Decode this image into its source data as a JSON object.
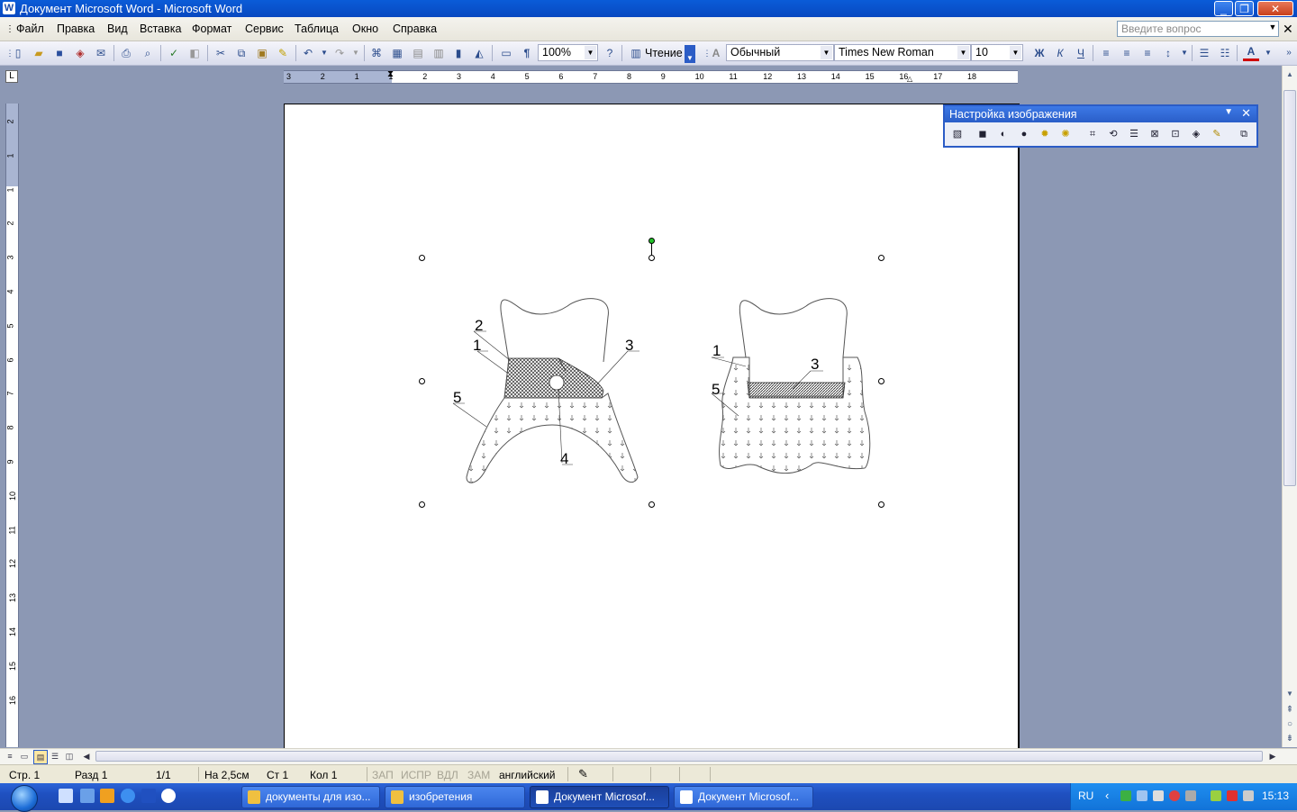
{
  "window": {
    "title": "Документ Microsoft Word - Microsoft Word",
    "app_icon": "W",
    "controls": [
      "_",
      "❐",
      "✕"
    ]
  },
  "menu": {
    "items": [
      "Файл",
      "Правка",
      "Вид",
      "Вставка",
      "Формат",
      "Сервис",
      "Таблица",
      "Окно",
      "Справка"
    ],
    "help_placeholder": "Введите вопрос",
    "help_close": "✕"
  },
  "toolbar": {
    "zoom": "100%",
    "reading_label": "Чтение",
    "style": "Обычный",
    "font": "Times New Roman",
    "font_size": "10",
    "bold": "Ж",
    "italic": "К",
    "underline": "Ч",
    "font_color_letter": "A"
  },
  "ruler": {
    "corner": "L",
    "horizontal_marks": [
      "3",
      "2",
      "1",
      "1",
      "2",
      "3",
      "4",
      "5",
      "6",
      "7",
      "8",
      "9",
      "10",
      "11",
      "12",
      "13",
      "14",
      "15",
      "16",
      "17",
      "18"
    ],
    "vertical_marks": [
      "2",
      "1",
      "1",
      "2",
      "3",
      "4",
      "5",
      "6",
      "7",
      "8",
      "9",
      "10",
      "11",
      "12",
      "13",
      "14",
      "15",
      "16"
    ]
  },
  "picture_toolbar": {
    "title": "Настройка изображения"
  },
  "figure": {
    "left_labels": [
      "2",
      "1",
      "3",
      "5",
      "4"
    ],
    "right_labels": [
      "1",
      "3",
      "5"
    ]
  },
  "status": {
    "page": "Стр. 1",
    "section": "Разд 1",
    "pages": "1/1",
    "at": "На 2,5см",
    "line": "Ст 1",
    "col": "Кол 1",
    "rec": "ЗАП",
    "trk": "ИСПР",
    "ext": "ВДЛ",
    "ovr": "ЗАМ",
    "language": "английский"
  },
  "taskbar": {
    "tasks": [
      {
        "label": "документы для изо...",
        "active": false
      },
      {
        "label": "изобретения",
        "active": false
      },
      {
        "label": "Документ Microsof...",
        "active": true
      },
      {
        "label": "Документ Microsof...",
        "active": false
      }
    ],
    "language": "RU",
    "clock": "15:13"
  },
  "colors": {
    "titlebar": "#0a5cd8",
    "workspace": "#8c98b4",
    "taskbar": "#1f50c0",
    "tray": "#1273d8"
  }
}
